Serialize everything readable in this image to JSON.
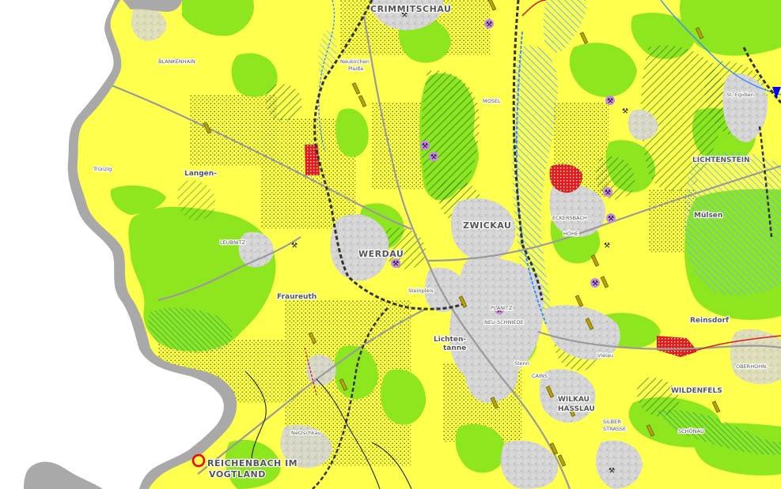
{
  "map": {
    "colors": {
      "background": "#ffffff",
      "outside_mask": "#a9a9a9",
      "agriculture": "#ffff4d",
      "forest": "#8ee61e",
      "settlement": "#d8d8d8",
      "water_hatch": "#64b4ff",
      "forest_hatch": "#2e7d32",
      "red_area": "#e01e1e",
      "railway": "#555555",
      "border": "#000000",
      "mine_symbol": "#b06ad9",
      "marker": "#ff0000"
    },
    "labels": {
      "crimmitschau": "CRIMMITSCHAU",
      "werdau": "WERDAU",
      "zwickau": "ZWICKAU",
      "wilkau_hasslau_1": "WILKAU",
      "wilkau_hasslau_2": "HASSLAU",
      "reichenbach_1": "REICHENBACH IM",
      "reichenbach_2": "VOGTLAND",
      "lichtentanne_1": "Lichten-",
      "lichtentanne_2": "tanne",
      "langenbernsdorf": "Langen-",
      "mulsen": "Mülsen",
      "reinsdorf": "Reinsdorf",
      "wildenfels": "WILDENFELS",
      "st_egidien": "St. Egidien",
      "lichtenstein": "LICHTENSTEIN",
      "blankenhain": "BLANKENHAIN",
      "neukirchen_1": "Neukirchen",
      "neukirchen_2": "Pleiße",
      "mosel": "MOSEL",
      "eckersbach": "ECKERSBACH",
      "hohe": "HÖHE",
      "planitz": "PLANITZ",
      "neu_schmiedefeld": "NEU-SCHNIEDE",
      "vielau": "Vielau",
      "schonau": "SCHÖNAU",
      "silberstrasse_1": "SILBER",
      "silberstrasse_2": "STRASSE",
      "cainsdorf": "CAINS",
      "leubnitz": "LEUBNITZ",
      "steinpleis": "Steinpleis",
      "nettzschkau": "Netzschkau",
      "trunzig": "Trünzig",
      "oberhohndorf": "OBERHOHN-",
      "stenn": "Stenn",
      "fraureuth": "Fraureuth"
    },
    "icons": [
      {
        "name": "mine-symbol-icon",
        "count": 14
      },
      {
        "name": "elevation-marker-icon",
        "count": 20
      },
      {
        "name": "location-ring-icon",
        "count": 1
      }
    ]
  }
}
